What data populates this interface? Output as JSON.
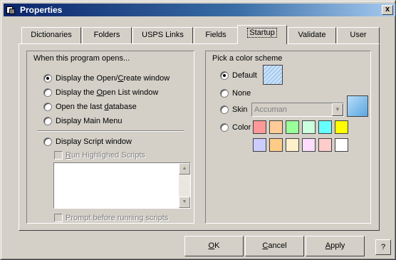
{
  "window": {
    "title": "Properties",
    "close_glyph": "x",
    "app_icon": "properties-app-icon"
  },
  "tabs": [
    {
      "label": "Dictionaries"
    },
    {
      "label": "Folders"
    },
    {
      "label": "USPS Links"
    },
    {
      "label": "Fields"
    },
    {
      "label": "Startup",
      "active": true
    },
    {
      "label": "Validate"
    },
    {
      "label": "User"
    }
  ],
  "open_group": {
    "title": "When this program opens...",
    "options": [
      {
        "pre": "Display the Open/",
        "key": "C",
        "post": "reate window",
        "checked": true
      },
      {
        "pre": "Display the ",
        "key": "O",
        "post": "pen List window",
        "checked": false
      },
      {
        "pre": "Open the last ",
        "key": "d",
        "post": "atabase",
        "checked": false
      },
      {
        "pre": "Display Main Menu",
        "key": "",
        "post": "",
        "checked": false
      },
      {
        "pre": "Display Script window",
        "key": "",
        "post": "",
        "checked": false
      }
    ],
    "run_scripts": {
      "pre": "",
      "key": "R",
      "post": "un Highlighed Scripts",
      "checked": false
    },
    "prompt_scripts": {
      "pre": "Prompt before running scripts",
      "checked": false
    }
  },
  "color_group": {
    "title": "Pick a color scheme",
    "default_label": "Default",
    "none_label": "None",
    "skin_label": "Skin",
    "skin_value": "Accuman",
    "color_label": "Color",
    "selected": "Default",
    "default_preview": "#a6caf0",
    "skin_preview": "#8ec6f0",
    "swatches": [
      "#ff9999",
      "#ffcc99",
      "#99ff99",
      "#ccffdd",
      "#66ffff",
      "#ffff00",
      "#ccccff",
      "#ffcc88",
      "#fff0cc",
      "#ffddff",
      "#ffcccc",
      "#ffffff"
    ]
  },
  "buttons": {
    "ok": {
      "key": "O",
      "rest": "K"
    },
    "cancel": {
      "key": "C",
      "rest": "ancel"
    },
    "apply": {
      "key": "A",
      "rest": "pply"
    },
    "help": "?"
  }
}
